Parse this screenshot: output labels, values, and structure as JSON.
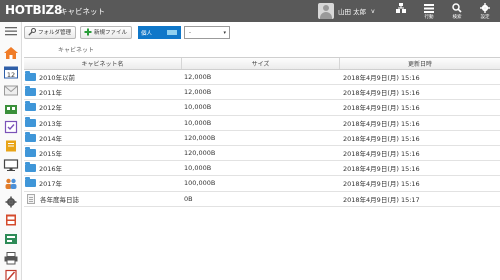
{
  "app": {
    "logo": "HOTBIZ8",
    "title": "キャビネット"
  },
  "user": {
    "name": "山田 太郎",
    "caret": "v"
  },
  "header_buttons": [
    {
      "name": "org-button",
      "label": ""
    },
    {
      "name": "activity-button",
      "label": "行動"
    },
    {
      "name": "search-button",
      "label": "検索"
    },
    {
      "name": "settings-button",
      "label": "設定"
    }
  ],
  "toolbar": {
    "folder_manage": "フォルダ管理",
    "new_file": "新規ファイル",
    "scope_label": "個人",
    "scope_value": "-"
  },
  "breadcrumb": "キャビネット",
  "table": {
    "columns": [
      "キャビネット名",
      "サイズ",
      "更新日時"
    ],
    "rows": [
      {
        "name": "2010年以前",
        "size": "12,000B",
        "updated": "2018年4月9日(月) 15:16",
        "kind": "folder"
      },
      {
        "name": "2011年",
        "size": "12,000B",
        "updated": "2018年4月9日(月) 15:16",
        "kind": "folder"
      },
      {
        "name": "2012年",
        "size": "10,000B",
        "updated": "2018年4月9日(月) 15:16",
        "kind": "folder"
      },
      {
        "name": "2013年",
        "size": "10,000B",
        "updated": "2018年4月9日(月) 15:16",
        "kind": "folder"
      },
      {
        "name": "2014年",
        "size": "120,000B",
        "updated": "2018年4月9日(月) 15:16",
        "kind": "folder"
      },
      {
        "name": "2015年",
        "size": "120,000B",
        "updated": "2018年4月9日(月) 15:16",
        "kind": "folder"
      },
      {
        "name": "2016年",
        "size": "10,000B",
        "updated": "2018年4月9日(月) 15:16",
        "kind": "folder"
      },
      {
        "name": "2017年",
        "size": "100,000B",
        "updated": "2018年4月9日(月) 15:16",
        "kind": "folder"
      },
      {
        "name": "各年度毎日誌",
        "size": "0B",
        "updated": "2018年4月9日(月) 15:17",
        "kind": "document"
      }
    ]
  },
  "rail": {
    "items": [
      {
        "icon": "home-icon",
        "color": "#f07c28"
      },
      {
        "icon": "calendar-icon",
        "color": "#2f5fa8"
      },
      {
        "icon": "mail-icon",
        "color": "#9a9a9a"
      },
      {
        "icon": "facility-icon",
        "color": "#3a8f3a"
      },
      {
        "icon": "todo-icon",
        "color": "#7a52b8"
      },
      {
        "icon": "notebook-icon",
        "color": "#e8a417"
      },
      {
        "icon": "monitor-icon",
        "color": "#444444"
      },
      {
        "icon": "people-icon",
        "color": "#e17c2a"
      },
      {
        "icon": "settings-gear-icon",
        "color": "#555555"
      },
      {
        "icon": "cabinet-icon",
        "color": "#d44b2c"
      },
      {
        "icon": "workflow-icon",
        "color": "#2e8b57"
      },
      {
        "icon": "printer-icon",
        "color": "#555555"
      },
      {
        "icon": "report-icon",
        "color": "#c0392b"
      }
    ]
  }
}
